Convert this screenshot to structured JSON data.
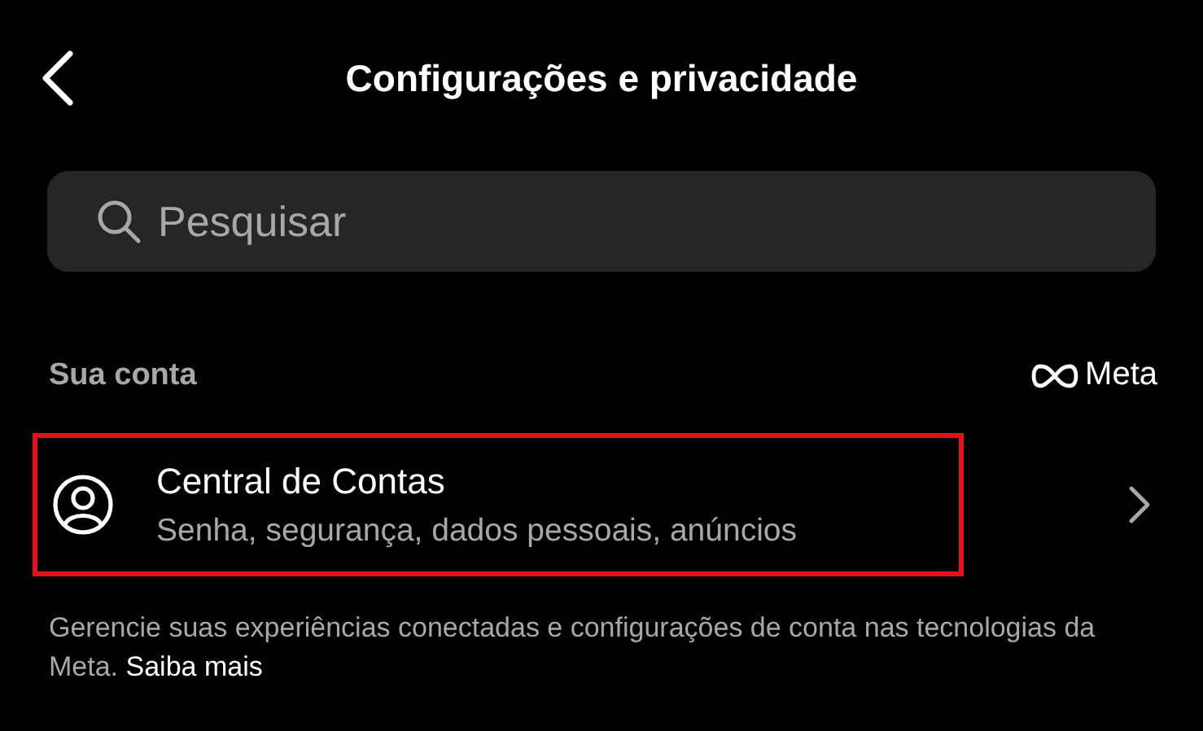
{
  "header": {
    "title": "Configurações e privacidade"
  },
  "search": {
    "placeholder": "Pesquisar"
  },
  "section": {
    "title": "Sua conta",
    "brand": "Meta"
  },
  "items": [
    {
      "title": "Central de Contas",
      "subtitle": "Senha, segurança, dados pessoais, anúncios",
      "highlighted": true
    }
  ],
  "footer": {
    "text": "Gerencie suas experiências conectadas e configurações de conta nas tecnologias da Meta.",
    "link": "Saiba mais"
  }
}
